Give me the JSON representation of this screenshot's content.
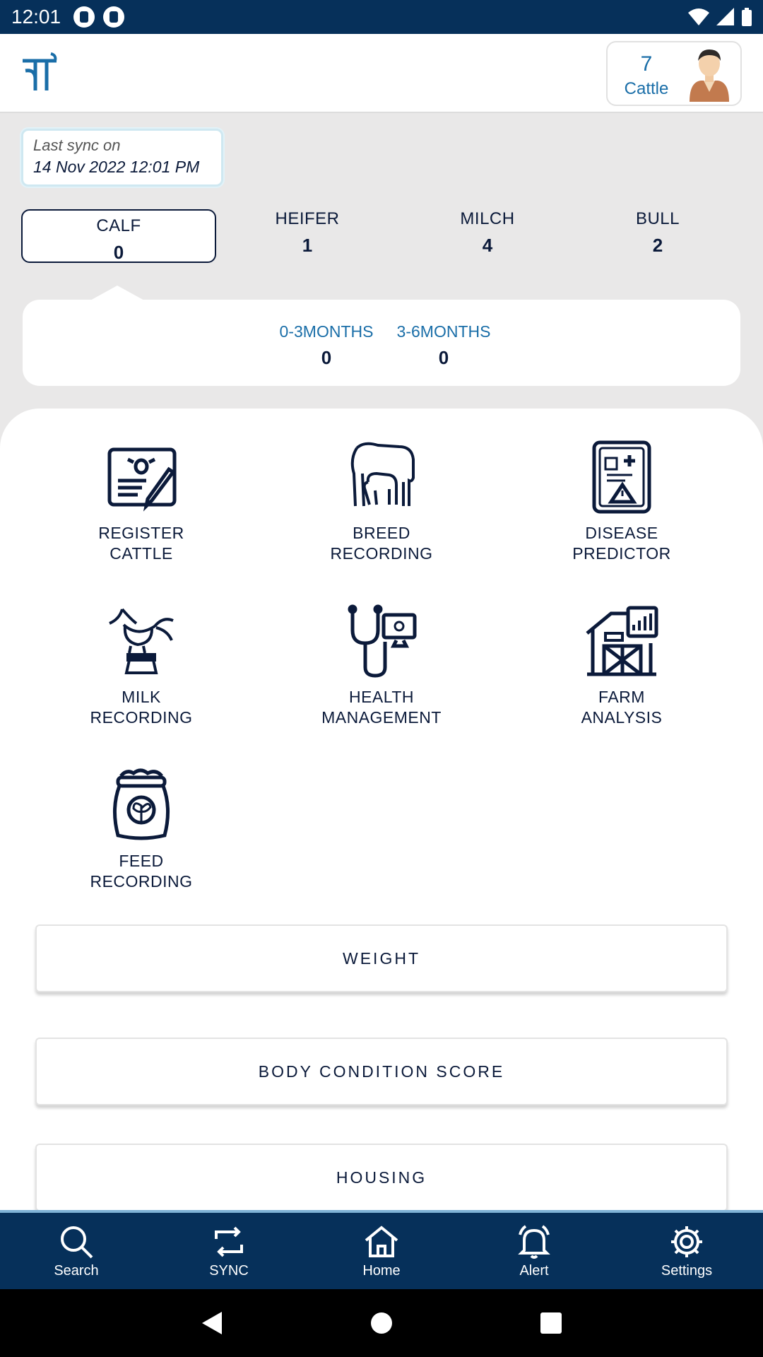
{
  "status_bar": {
    "time": "12:01"
  },
  "header": {
    "logo_text": "नि",
    "cattle_count": "7",
    "cattle_label": "Cattle"
  },
  "sync": {
    "label": "Last sync on",
    "date": "14 Nov 2022 12:01 PM"
  },
  "categories": [
    {
      "name": "CALF",
      "count": "0",
      "active": true
    },
    {
      "name": "HEIFER",
      "count": "1"
    },
    {
      "name": "MILCH",
      "count": "4"
    },
    {
      "name": "BULL",
      "count": "2"
    }
  ],
  "calf_ages": [
    {
      "name": "0-3MONTHS",
      "count": "0"
    },
    {
      "name": "3-6MONTHS",
      "count": "0"
    }
  ],
  "tiles": [
    {
      "line1": "REGISTER",
      "line2": "CATTLE",
      "icon": "register-cattle-icon"
    },
    {
      "line1": "BREED",
      "line2": "RECORDING",
      "icon": "breed-recording-icon"
    },
    {
      "line1": "DISEASE",
      "line2": "PREDICTOR",
      "icon": "disease-predictor-icon"
    },
    {
      "line1": "MILK",
      "line2": "RECORDING",
      "icon": "milk-recording-icon"
    },
    {
      "line1": "HEALTH",
      "line2": "MANAGEMENT",
      "icon": "health-management-icon"
    },
    {
      "line1": "FARM",
      "line2": "ANALYSIS",
      "icon": "farm-analysis-icon"
    },
    {
      "line1": "FEED",
      "line2": "RECORDING",
      "icon": "feed-recording-icon"
    }
  ],
  "buttons": {
    "weight": "WEIGHT",
    "bcs": "BODY CONDITION SCORE",
    "housing": "HOUSING"
  },
  "bottom_nav": [
    {
      "label": "Search",
      "icon": "search-icon"
    },
    {
      "label": "SYNC",
      "icon": "sync-icon"
    },
    {
      "label": "Home",
      "icon": "home-icon"
    },
    {
      "label": "Alert",
      "icon": "bell-icon"
    },
    {
      "label": "Settings",
      "icon": "gear-icon"
    }
  ],
  "colors": {
    "primary_dark": "#06305a",
    "accent_blue": "#1a6ea8",
    "ink": "#0b1a3a"
  }
}
